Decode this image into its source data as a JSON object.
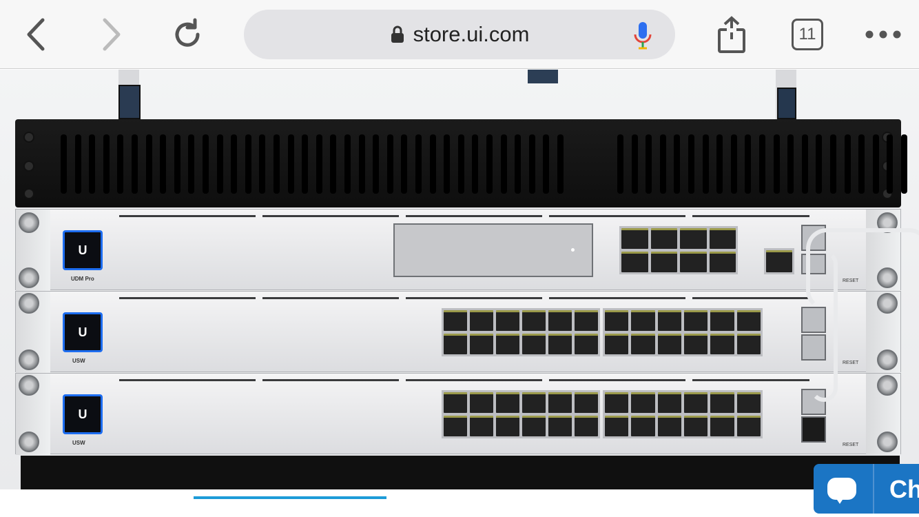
{
  "browser": {
    "url_host": "store.ui.com",
    "tab_count": "11",
    "buttons": {
      "back": "back",
      "forward": "forward",
      "reload": "reload",
      "share": "share",
      "more": "more"
    }
  },
  "hero": {
    "units": [
      {
        "model_label": "UDM Pro",
        "reset_label": "RESET",
        "logo_letter": "U"
      },
      {
        "model_label": "USW",
        "reset_label": "RESET",
        "logo_letter": "U"
      },
      {
        "model_label": "USW",
        "reset_label": "RESET",
        "logo_letter": "U"
      }
    ]
  },
  "carousel": {
    "progress": 0.21
  },
  "chat": {
    "label": "Ch"
  },
  "colors": {
    "accent": "#1b75c4",
    "progress": "#1d9bd8",
    "mic_blue": "#2d6ff0",
    "mic_red": "#e2463b"
  }
}
